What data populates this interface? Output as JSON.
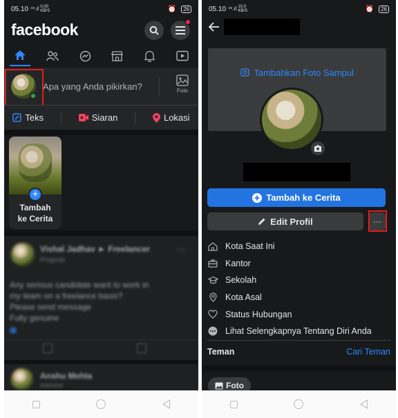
{
  "left": {
    "status": {
      "time": "05.10",
      "signal": "⁴ˢ.ıl",
      "speed_top": "0,00",
      "speed_bottom": "KB/S",
      "battery": "26"
    },
    "logo": "facebook",
    "icons": {
      "search": "search-icon",
      "menu": "menu-icon"
    },
    "tabs": [
      {
        "name": "home-icon"
      },
      {
        "name": "friends-icon"
      },
      {
        "name": "messenger-icon"
      },
      {
        "name": "marketplace-icon"
      },
      {
        "name": "notifications-icon"
      },
      {
        "name": "watch-icon"
      }
    ],
    "composer": {
      "placeholder": "Apa yang Anda pikirkan?",
      "foto_label": "Foto"
    },
    "actions": [
      {
        "label": "Teks",
        "icon": "edit-icon",
        "color": "#2d88ff"
      },
      {
        "label": "Siaran",
        "icon": "video-icon",
        "color": "#f3425f"
      },
      {
        "label": "Lokasi",
        "icon": "location-pin-icon",
        "color": "#f3425f"
      }
    ],
    "story": {
      "line1": "Tambah",
      "line2": "ke Cerita"
    },
    "blurred_post": {
      "author": "Vishal Jadhav ► Freelancer",
      "sub": "Projects",
      "text1": "Any serious candidate want to work in",
      "text2": "my team on a freelance basis?",
      "text3": "Please send message",
      "text4": "Fully genuine",
      "next_author": "Anshu Mehta",
      "next_sub": "Interest"
    }
  },
  "right": {
    "status": {
      "time": "05.10",
      "signal": "⁴ˢ.ıl",
      "speed_top": "10,0",
      "speed_bottom": "KB/S",
      "battery": "26"
    },
    "cover_label": "Tambahkan Foto Sampul",
    "add_story_button": "Tambah ke Cerita",
    "edit_profile_button": "Edit Profil",
    "more_button": "···",
    "info": [
      {
        "label": "Kota Saat Ini",
        "icon": "home-outline-icon"
      },
      {
        "label": "Kantor",
        "icon": "briefcase-icon"
      },
      {
        "label": "Sekolah",
        "icon": "graduation-cap-icon"
      },
      {
        "label": "Kota Asal",
        "icon": "location-outline-icon"
      },
      {
        "label": "Status Hubungan",
        "icon": "heart-outline-icon"
      },
      {
        "label": "Lihat Selengkapnya Tentang Diri Anda",
        "icon": "more-circle-icon"
      }
    ],
    "friends": {
      "title": "Teman",
      "action": "Cari Teman"
    },
    "photos_pill": "Foto"
  },
  "colors": {
    "accent": "#2d88ff",
    "highlight": "#e31d1d",
    "bg": "#18191a",
    "card": "#242526"
  }
}
